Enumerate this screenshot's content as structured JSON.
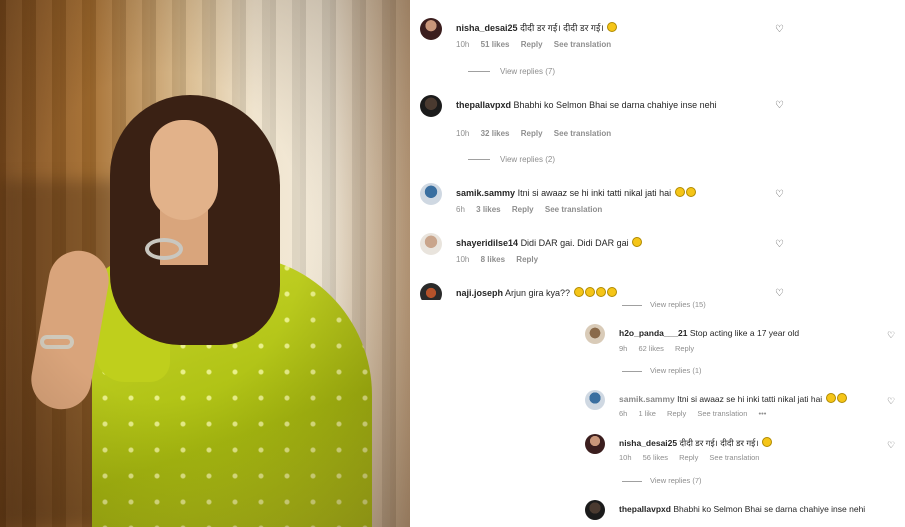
{
  "colors": {
    "meta": "#8e8e8e",
    "text": "#262626"
  },
  "top_comments": [
    {
      "user": "nisha_desai25",
      "text": "दीदी डर गई। दीदी डर गई।",
      "emojis": 1,
      "time": "10h",
      "likes": "51 likes",
      "reply": "Reply",
      "see_translation": "See translation",
      "view_replies": "View replies (7)"
    },
    {
      "user": "thepallavpxd",
      "text": "Bhabhi ko Selmon Bhai se darna chahiye inse nehi",
      "emojis": 0,
      "time": "10h",
      "likes": "32 likes",
      "reply": "Reply",
      "see_translation": "See translation",
      "view_replies": "View replies (2)"
    },
    {
      "user": "samik.sammy",
      "text": "Itni si awaaz se hi inki tatti nikal jati hai",
      "emojis": 2,
      "time": "6h",
      "likes": "3 likes",
      "reply": "Reply",
      "see_translation": "See translation"
    },
    {
      "user": "shayeridilse14",
      "text": "Didi DAR gai. Didi DAR gai",
      "emojis": 1,
      "time": "10h",
      "likes": "8 likes",
      "reply": "Reply"
    },
    {
      "user": "naji.joseph",
      "text": "Arjun gira kya??",
      "emojis": 4
    }
  ],
  "bottom_view_replies_top": "View replies (15)",
  "bottom_comments": [
    {
      "user": "h2o_panda___21",
      "text": "Stop acting like a 17 year old",
      "emojis": 0,
      "time": "9h",
      "likes": "62 likes",
      "reply": "Reply",
      "view_replies": "View replies (1)"
    },
    {
      "user": "samik.sammy",
      "text": "Itni si awaaz se hi inki tatti nikal jati hai",
      "emojis": 2,
      "time": "6h",
      "likes": "1 like",
      "reply": "Reply",
      "see_translation": "See translation",
      "more": "•••"
    },
    {
      "user": "nisha_desai25",
      "text": "दीदी डर गई। दीदी डर गई।",
      "emojis": 1,
      "time": "10h",
      "likes": "56 likes",
      "reply": "Reply",
      "see_translation": "See translation",
      "view_replies": "View replies (7)"
    },
    {
      "user": "thepallavpxd",
      "text": "Bhabhi ko Selmon Bhai se darna chahiye inse nehi",
      "emojis": 0
    }
  ]
}
